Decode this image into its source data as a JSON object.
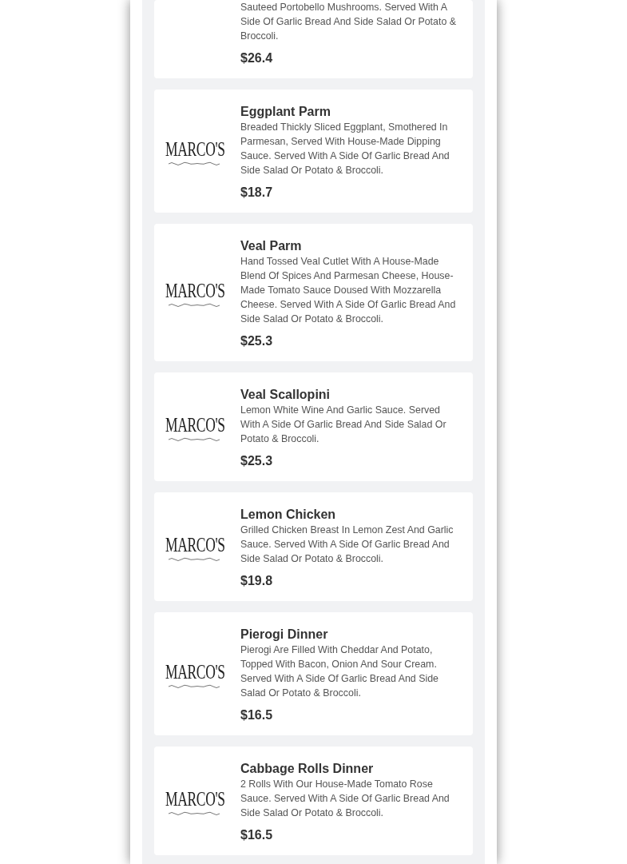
{
  "items": [
    {
      "kind": "partial",
      "description": "Sauteed Portobello Mushrooms. Served With A Side Of Garlic Bread And Side Salad Or Potato & Broccoli.",
      "price": "$26.4"
    },
    {
      "kind": "full",
      "logo": "MARCO'S",
      "name": "Eggplant Parm",
      "description": "Breaded Thickly Sliced Eggplant, Smothered In Parmesan, Served With House-Made Dipping Sauce. Served With A Side Of Garlic Bread And Side Salad Or Potato & Broccoli.",
      "price": "$18.7"
    },
    {
      "kind": "full",
      "logo": "MARCO'S",
      "name": "Veal Parm",
      "description": "Hand Tossed Veal Cutlet With A House-Made Blend Of Spices And Parmesan Cheese, House-Made Tomato Sauce Doused With Mozzarella Cheese. Served With A Side Of Garlic Bread And Side Salad Or Potato & Broccoli.",
      "price": "$25.3"
    },
    {
      "kind": "full",
      "logo": "MARCO'S",
      "name": "Veal Scallopini",
      "description": "Lemon White Wine And Garlic Sauce. Served With A Side Of Garlic Bread And Side Salad Or Potato & Broccoli.",
      "price": "$25.3"
    },
    {
      "kind": "full",
      "logo": "MARCO'S",
      "name": "Lemon Chicken",
      "description": "Grilled Chicken Breast In Lemon Zest And Garlic Sauce. Served With A Side Of Garlic Bread And Side Salad Or Potato & Broccoli.",
      "price": "$19.8"
    },
    {
      "kind": "full",
      "logo": "MARCO'S",
      "name": "Pierogi Dinner",
      "description": "Pierogi Are Filled With Cheddar And Potato, Topped With Bacon, Onion And Sour Cream. Served With A Side Of Garlic Bread And Side Salad Or Potato & Broccoli.",
      "price": "$16.5"
    },
    {
      "kind": "full",
      "logo": "MARCO'S",
      "name": "Cabbage Rolls Dinner",
      "description": "2 Rolls With Our House-Made Tomato Rose Sauce. Served With A Side Of Garlic Bread And Side Salad Or Potato & Broccoli.",
      "price": "$16.5"
    }
  ]
}
